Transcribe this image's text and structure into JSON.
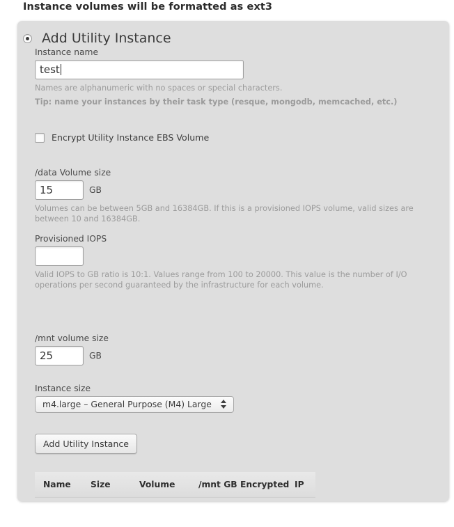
{
  "page": {
    "heading": "Instance volumes will be formatted as ext3"
  },
  "panel": {
    "section_title": "Add Utility Instance",
    "radio_checked": true,
    "fields": {
      "instance_name": {
        "label": "Instance name",
        "value": "test",
        "placeholder": "",
        "hint_line1": "Names are alphanumeric with no spaces or special characters.",
        "hint_line2": "Tip: name your instances by their task type (resque, mongodb, memcached, etc.)"
      },
      "encrypt": {
        "label": "Encrypt Utility Instance EBS Volume",
        "checked": false
      },
      "data_volume": {
        "label": "/data Volume size",
        "value": "15",
        "unit": "GB",
        "hint": "Volumes can be between 5GB and 16384GB. If this is a provisioned IOPS volume, valid sizes are between 10 and 16384GB."
      },
      "provisioned_iops": {
        "label": "Provisioned IOPS",
        "value": "",
        "placeholder": "",
        "hint": "Valid IOPS to GB ratio is 10:1. Values range from 100 to 20000. This value is the number of I/O operations per second guaranteed by the infrastructure for each volume."
      },
      "mnt_volume": {
        "label": "/mnt volume size",
        "value": "25",
        "unit": "GB"
      },
      "instance_size": {
        "label": "Instance size",
        "selected": "m4.large – General Purpose (M4) Large"
      }
    },
    "submit_button": "Add Utility Instance",
    "table": {
      "columns": [
        "Name",
        "Size",
        "Volume",
        "/mnt GB",
        "Encrypted",
        "IP"
      ],
      "rows": []
    }
  },
  "colors": {
    "panel_bg": "#dedede",
    "page_bg": "#ffffff",
    "text": "#333333",
    "hint": "#9b9b9b",
    "input_bg": "#ffffff",
    "border": "#9d9d9d"
  }
}
